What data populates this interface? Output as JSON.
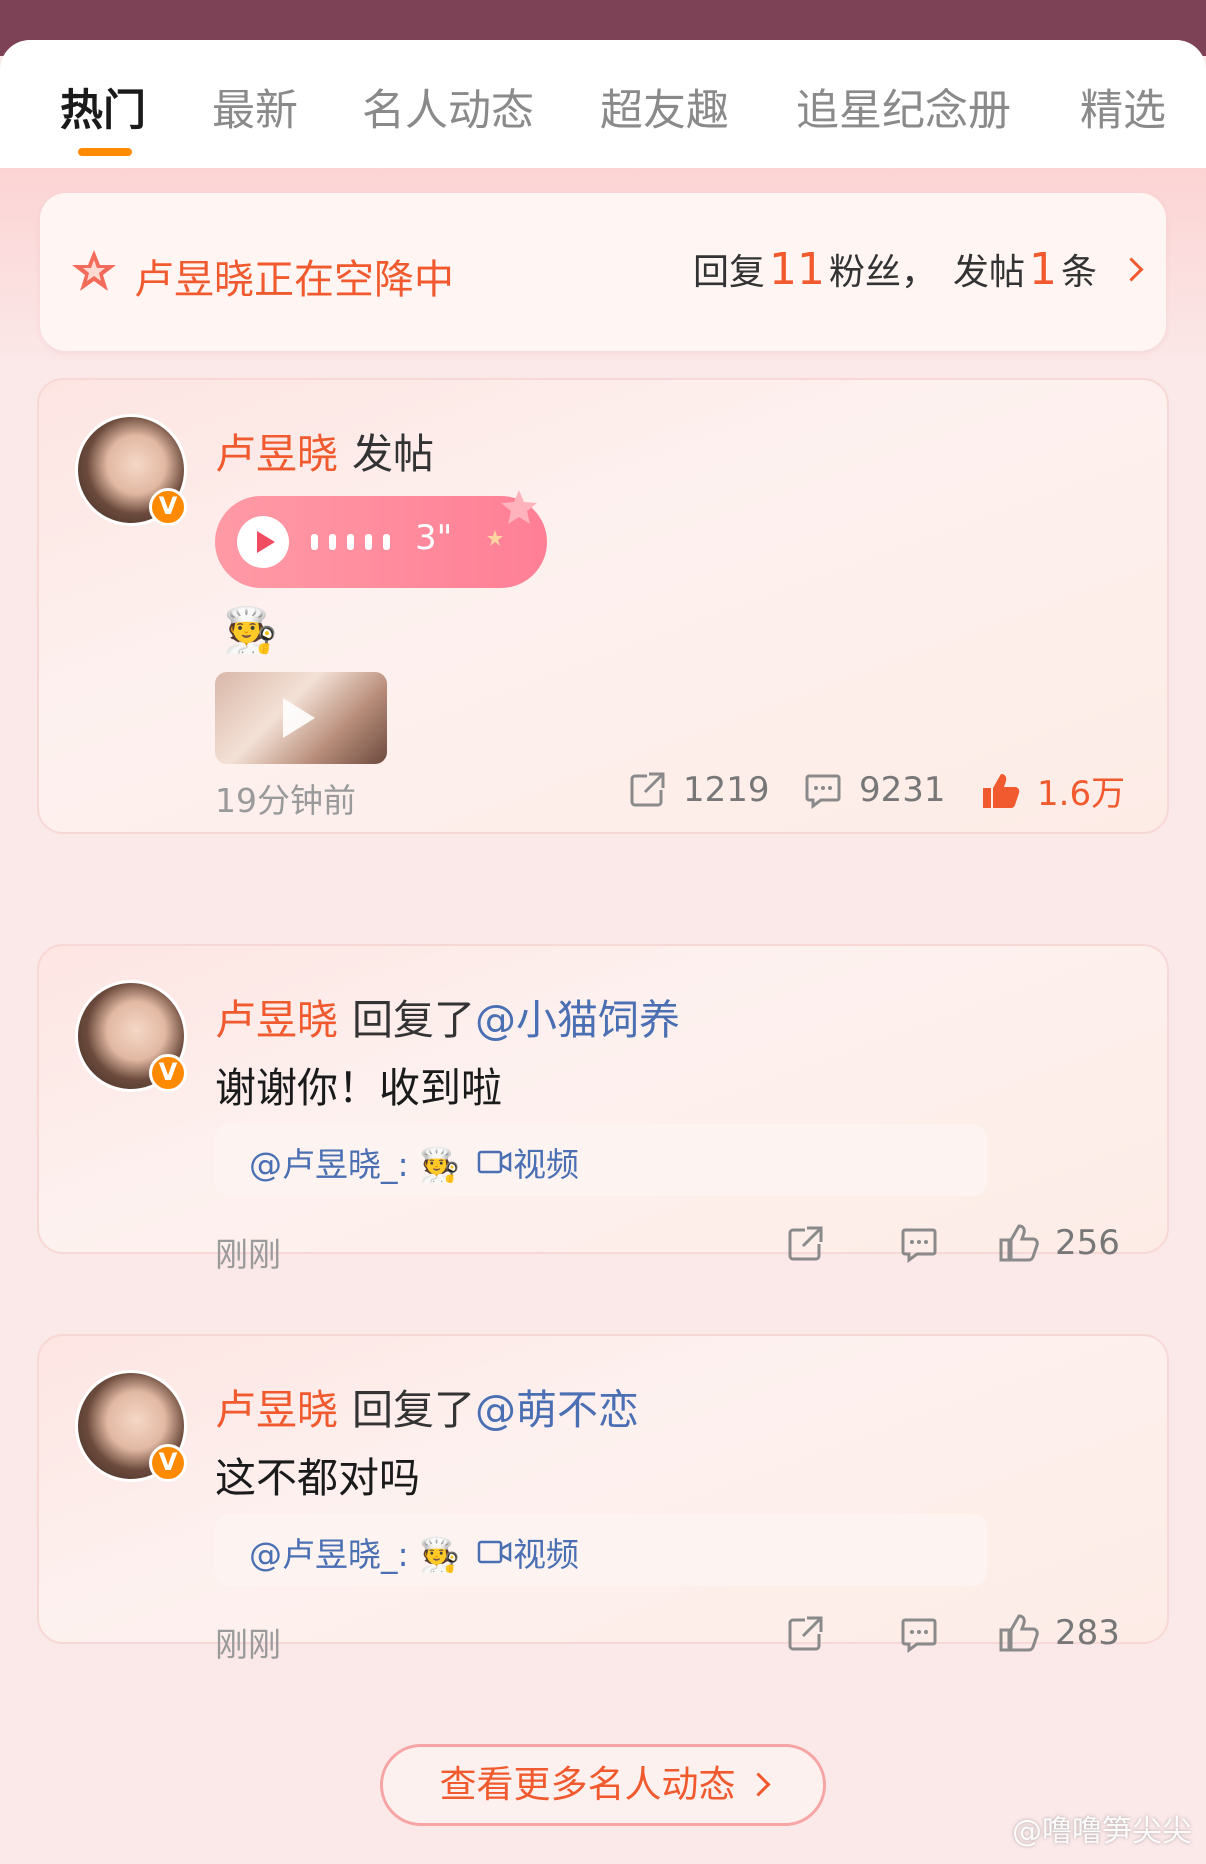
{
  "tabs": [
    {
      "label": "热门",
      "active": true
    },
    {
      "label": "最新"
    },
    {
      "label": "名人动态"
    },
    {
      "label": "超友趣"
    },
    {
      "label": "追星纪念册"
    },
    {
      "label": "精选"
    }
  ],
  "banner": {
    "title": "卢昱晓正在空降中",
    "reply_prefix": "回复",
    "reply_count": "11",
    "fans_label": "粉丝，",
    "post_prefix": "发帖",
    "post_count": "1",
    "post_suffix": "条"
  },
  "posts": [
    {
      "name": "卢昱晓",
      "action": "发帖",
      "voice_duration": "3\"",
      "emoji": "🧑‍🍳",
      "time": "19分钟前",
      "share_count": "1219",
      "comment_count": "9231",
      "like_count": "1.6万"
    },
    {
      "name": "卢昱晓",
      "action": "回复了",
      "mention": "@小猫饲养",
      "text": "谢谢你！收到啦",
      "quote_text": "@卢昱晓_:",
      "quote_emoji": "🧑‍🍳",
      "quote_video": "视频",
      "time": "刚刚",
      "like_count": "256"
    },
    {
      "name": "卢昱晓",
      "action": "回复了",
      "mention": "@萌不恋",
      "text": "这不都对吗",
      "quote_text": "@卢昱晓_:",
      "quote_emoji": "🧑‍🍳",
      "quote_video": "视频",
      "time": "刚刚",
      "like_count": "283"
    }
  ],
  "more_button": "查看更多名人动态",
  "watermark": "@噜噜笋尖尖",
  "colors": {
    "accent": "#f05a2e",
    "tab_indicator": "#ff8a00",
    "link": "#4a6fb3",
    "status_bar": "#7e4256"
  }
}
